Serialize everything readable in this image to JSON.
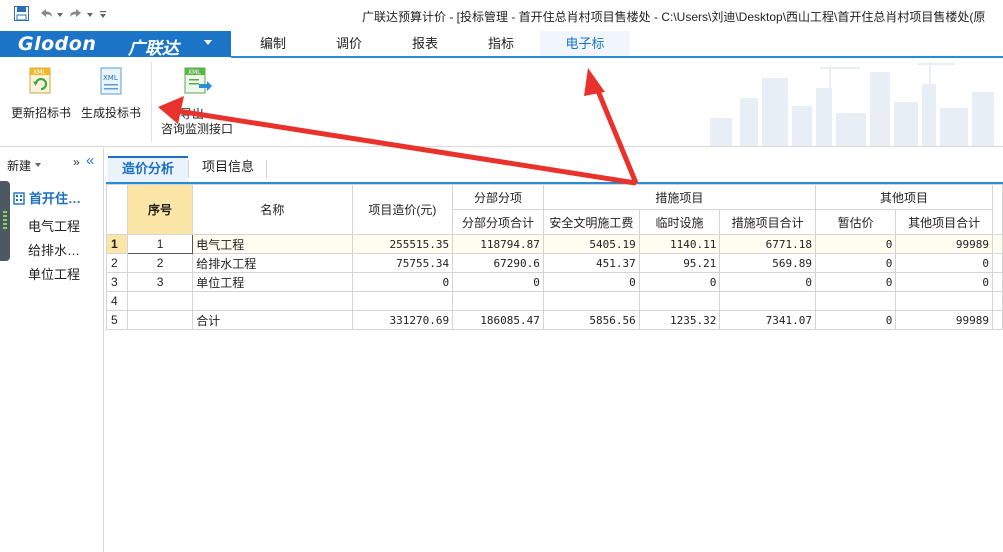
{
  "window": {
    "title": "广联达预算计价 - [投标管理 - 首开住总肖村项目售楼处 - C:\\Users\\刘迪\\Desktop\\西山工程\\首开住总肖村项目售楼处(原"
  },
  "brand": {
    "logo": "Glodon",
    "logo_cn": "广联达"
  },
  "menu": {
    "tabs": [
      {
        "label": "编制"
      },
      {
        "label": "调价"
      },
      {
        "label": "报表"
      },
      {
        "label": "指标"
      },
      {
        "label": "电子标"
      }
    ],
    "active": "电子标"
  },
  "ribbon": {
    "update_bid": "更新招标书",
    "generate_bid": "生成投标书",
    "export_partial": "导出",
    "consult_api": "咨询监测接口"
  },
  "left_panel": {
    "new_label": "新建",
    "expand_glyph": "»",
    "collapse_glyph": "«",
    "root": "首开住…",
    "items": [
      "电气工程",
      "给排水…",
      "单位工程"
    ]
  },
  "content_tabs": [
    "造价分析",
    "项目信息"
  ],
  "grid": {
    "headers": {
      "seq": "序号",
      "name": "名称",
      "cost": "项目造价(元)",
      "sub": "分部分项",
      "sub_total": "分部分项合计",
      "measures": "措施项目",
      "safety": "安全文明施工费",
      "temp": "临时设施",
      "measures_total": "措施项目合计",
      "other": "其他项目",
      "provisional": "暂估价",
      "other_total": "其他项目合计"
    },
    "rows": [
      {
        "rn": "1",
        "seq": "1",
        "name": "电气工程",
        "cost": "255515.35",
        "sub_total": "118794.87",
        "safety": "5405.19",
        "temp": "1140.11",
        "measures_total": "6771.18",
        "provisional": "0",
        "other_total": "99989"
      },
      {
        "rn": "2",
        "seq": "2",
        "name": "给排水工程",
        "cost": "75755.34",
        "sub_total": "67290.6",
        "safety": "451.37",
        "temp": "95.21",
        "measures_total": "569.89",
        "provisional": "0",
        "other_total": "0"
      },
      {
        "rn": "3",
        "seq": "3",
        "name": "单位工程",
        "cost": "0",
        "sub_total": "0",
        "safety": "0",
        "temp": "0",
        "measures_total": "0",
        "provisional": "0",
        "other_total": "0"
      },
      {
        "rn": "4",
        "seq": "",
        "name": "",
        "cost": "",
        "sub_total": "",
        "safety": "",
        "temp": "",
        "measures_total": "",
        "provisional": "",
        "other_total": ""
      },
      {
        "rn": "5",
        "seq": "",
        "name": "合计",
        "cost": "331270.69",
        "sub_total": "186085.47",
        "safety": "5856.56",
        "temp": "1235.32",
        "measures_total": "7341.07",
        "provisional": "0",
        "other_total": "99989"
      }
    ]
  },
  "colors": {
    "brand_blue": "#1b74c5",
    "accent_blue": "#2a8bd6",
    "selected_header": "#fbe6a8",
    "annotation_red": "#e8322b"
  }
}
